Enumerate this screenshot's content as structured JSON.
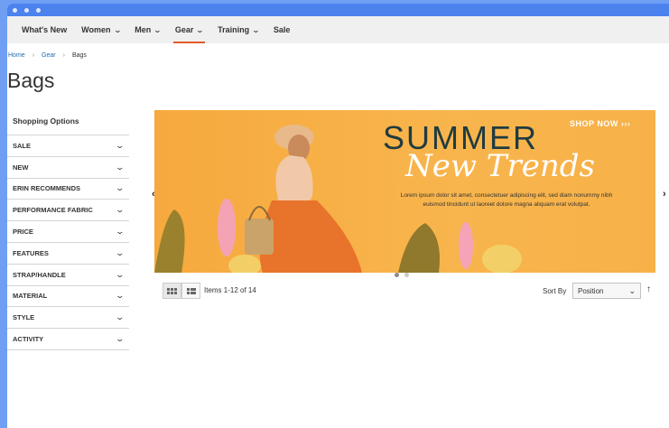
{
  "nav": {
    "items": [
      {
        "label": "What's New",
        "chevron": false
      },
      {
        "label": "Women",
        "chevron": true
      },
      {
        "label": "Men",
        "chevron": true
      },
      {
        "label": "Gear",
        "chevron": true,
        "active": true
      },
      {
        "label": "Training",
        "chevron": true
      },
      {
        "label": "Sale",
        "chevron": false
      }
    ]
  },
  "breadcrumb": {
    "home": "Home",
    "gear": "Gear",
    "current": "Bags"
  },
  "page_title": "Bags",
  "sidebar": {
    "heading": "Shopping Options",
    "filters": [
      "SALE",
      "NEW",
      "ERIN RECOMMENDS",
      "PERFORMANCE FABRIC",
      "PRICE",
      "FEATURES",
      "STRAP/HANDLE",
      "MATERIAL",
      "STYLE",
      "ACTIVITY"
    ]
  },
  "banner": {
    "shop_now": "SHOP NOW ›››",
    "headline": "SUMMER",
    "script": "New Trends",
    "body_line1": "Lorem ipsum dolor sit amet, consectetuer adipiscing elit, sed diam nonummy nibh",
    "body_line2": "euismod tincidunt ut laoreet dolore magna aliquam erat volutpat.",
    "colors": {
      "bg": "#f8b54d",
      "headline": "#1f3b3f",
      "script": "#ffffff",
      "accent": "#e8732a"
    }
  },
  "toolbar": {
    "items_count": "Items 1-12 of 14",
    "sort_label": "Sort By",
    "sort_value": "Position"
  },
  "icons": {
    "left_arrow": "chevron-left-icon",
    "right_arrow": "chevron-right-icon",
    "grid": "grid-icon",
    "list": "list-icon",
    "sort_dir": "arrow-up-icon"
  }
}
